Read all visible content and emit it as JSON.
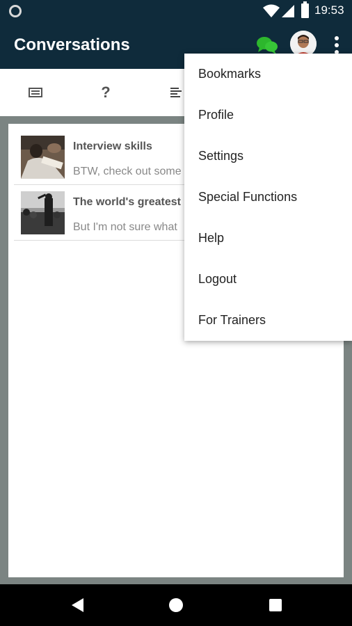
{
  "status_bar": {
    "time": "19:53",
    "icons": [
      "notification-circle-icon",
      "wifi-icon",
      "cell-signal-icon",
      "battery-icon"
    ]
  },
  "app_bar": {
    "title": "Conversations",
    "icons": [
      "chat-bubbles-icon",
      "avatar",
      "more-vert-icon"
    ],
    "accent_color": "#0f2b3b",
    "chat_icon_color": "#2db72d"
  },
  "tabs": {
    "icons": [
      "list-card-icon",
      "help-question-icon",
      "sort-lines-icon"
    ],
    "help_label": "?"
  },
  "conversations": [
    {
      "title": "Interview skills",
      "preview": "BTW, check out some"
    },
    {
      "title": "The world's greatest",
      "preview": "But I'm not sure what"
    }
  ],
  "menu": {
    "items": [
      "Bookmarks",
      "Profile",
      "Settings",
      "Special Functions",
      "Help",
      "Logout",
      "For Trainers"
    ]
  },
  "nav_bar": {
    "icons": [
      "back-triangle-icon",
      "home-circle-icon",
      "recents-square-icon"
    ]
  }
}
